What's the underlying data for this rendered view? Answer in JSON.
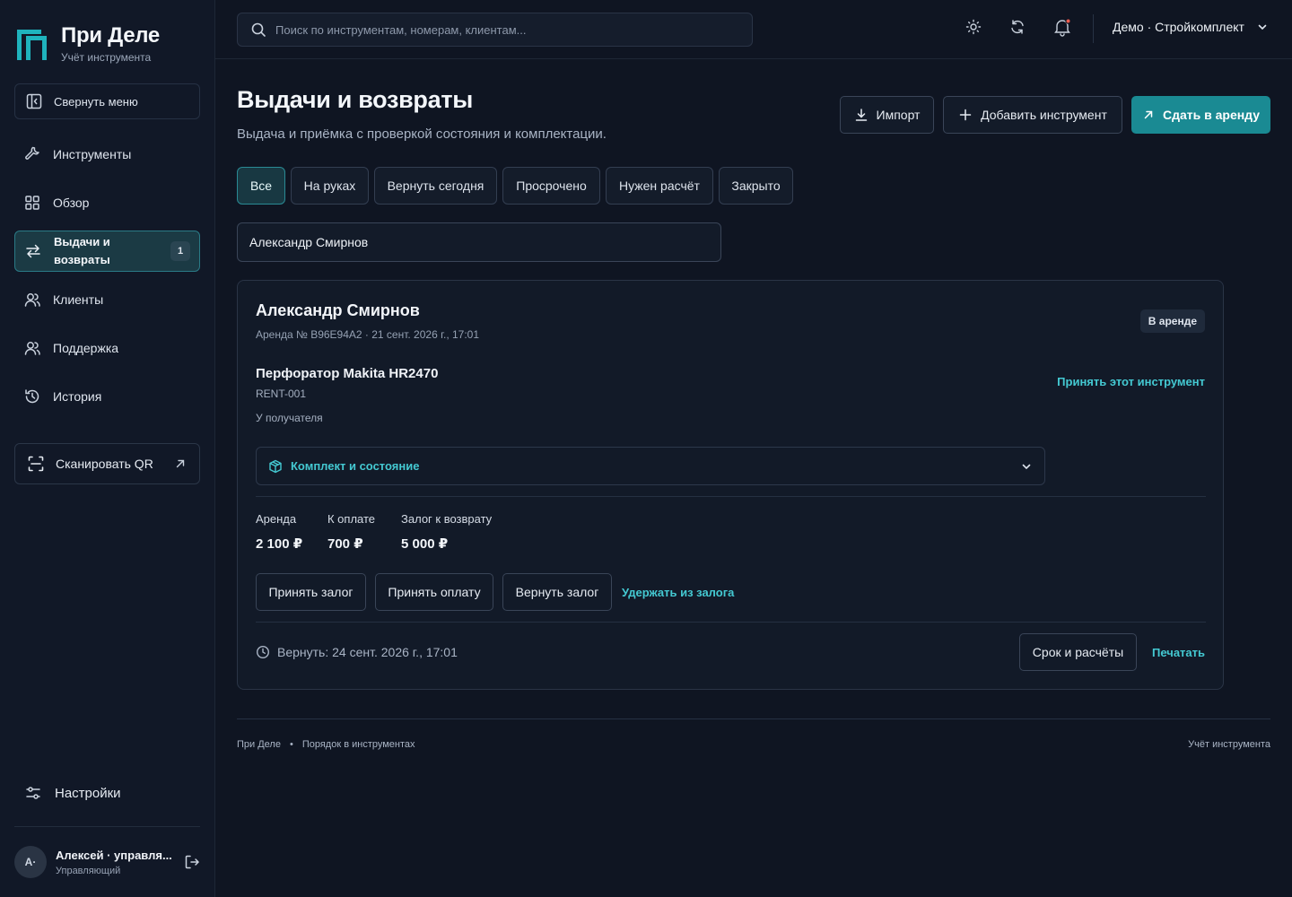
{
  "brand": {
    "title": "При Деле",
    "subtitle": "Учёт инструмента"
  },
  "sidebar": {
    "collapse_label": "Свернуть меню",
    "items": [
      {
        "label": "Инструменты",
        "icon": "wrench-icon"
      },
      {
        "label": "Обзор",
        "icon": "grid-icon"
      },
      {
        "label": "Выдачи и возвраты",
        "line1": "Выдачи и",
        "line2": "возвраты",
        "icon": "swap-arrows-icon",
        "badge": "1",
        "active": true
      },
      {
        "label": "Клиенты",
        "icon": "users-icon"
      },
      {
        "label": "Поддержка",
        "icon": "users-icon"
      },
      {
        "label": "История",
        "icon": "history-icon"
      }
    ],
    "scan_label": "Сканировать QR",
    "settings_label": "Настройки",
    "user": {
      "initials": "А·",
      "name": "Алексей · управля...",
      "role": "Управляющий"
    }
  },
  "topbar": {
    "search_placeholder": "Поиск по инструментам, номерам, клиентам...",
    "org": "Демо · Стройкомплект"
  },
  "header": {
    "title": "Выдачи и возвраты",
    "subtitle": "Выдача и приёмка с проверкой состояния и комплектации.",
    "import_label": "Импорт",
    "add_label": "Добавить инструмент",
    "rent_label": "Сдать в аренду"
  },
  "filters": [
    "Все",
    "На руках",
    "Вернуть сегодня",
    "Просрочено",
    "Нужен расчёт",
    "Закрыто"
  ],
  "active_filter": "Все",
  "client_filter": "Александр Смирнов",
  "rental": {
    "client": "Александр Смирнов",
    "meta": "Аренда № B96E94A2 · 21 сент. 2026 г., 17:01",
    "status": "В аренде",
    "tool_name": "Перфоратор Makita HR2470",
    "tool_code": "RENT-001",
    "tool_state": "У получателя",
    "accept_link": "Принять этот инструмент",
    "kit_label": "Комплект и состояние",
    "amounts": [
      {
        "label": "Аренда",
        "value": "2 100 ₽"
      },
      {
        "label": "К оплате",
        "value": "700 ₽"
      },
      {
        "label": "Залог к возврату",
        "value": "5 000 ₽"
      }
    ],
    "actions": [
      "Принять залог",
      "Принять оплату",
      "Вернуть залог"
    ],
    "hold_link": "Удержать из залога",
    "due": "Вернуть: 24 сент. 2026 г., 17:01",
    "terms_label": "Срок и расчёты",
    "print_label": "Печатать"
  },
  "footer": {
    "left1": "При Деле",
    "left2": "Порядок в инструментах",
    "right": "Учёт инструмента"
  },
  "colors": {
    "accent": "#1a8a93",
    "link": "#44c9d2",
    "background": "#0f1522",
    "sidebar": "#111827"
  }
}
